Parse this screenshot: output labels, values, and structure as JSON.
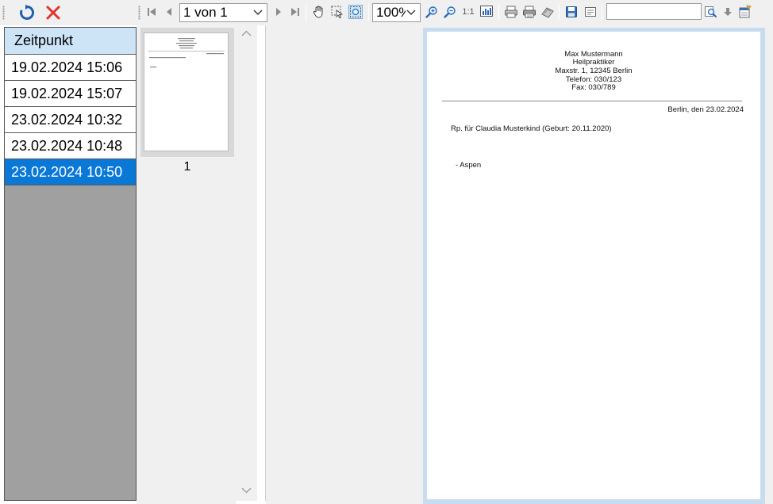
{
  "left_toolbar": {
    "refresh_icon": "refresh-icon",
    "delete_icon": "close-icon"
  },
  "grid": {
    "header": "Zeitpunkt",
    "rows": [
      "19.02.2024 15:06",
      "19.02.2024 15:07",
      "23.02.2024 10:32",
      "23.02.2024 10:48",
      "23.02.2024 10:50"
    ],
    "selected_index": 4
  },
  "viewer_toolbar": {
    "page_combo": "1 von 1",
    "zoom_combo": "100%",
    "actual_size_label": "1:1",
    "search_value": ""
  },
  "thumbnails": {
    "page_number": "1"
  },
  "document": {
    "header_lines": [
      "Max Mustermann",
      "Heilpraktiker",
      "Maxstr. 1, 12345 Berlin",
      "Telefon: 030/123",
      "Fax: 030/789"
    ],
    "date_line": "Berlin, den 23.02.2024",
    "rp_line": "Rp. für Claudia Musterkind (Geburt: 20.11.2020)",
    "item_line": "- Aspen"
  },
  "colors": {
    "selected_row": "#0a78d7",
    "header_bg": "#cde4f7",
    "delete_red": "#e0332b",
    "refresh_blue": "#1f5fb0"
  }
}
